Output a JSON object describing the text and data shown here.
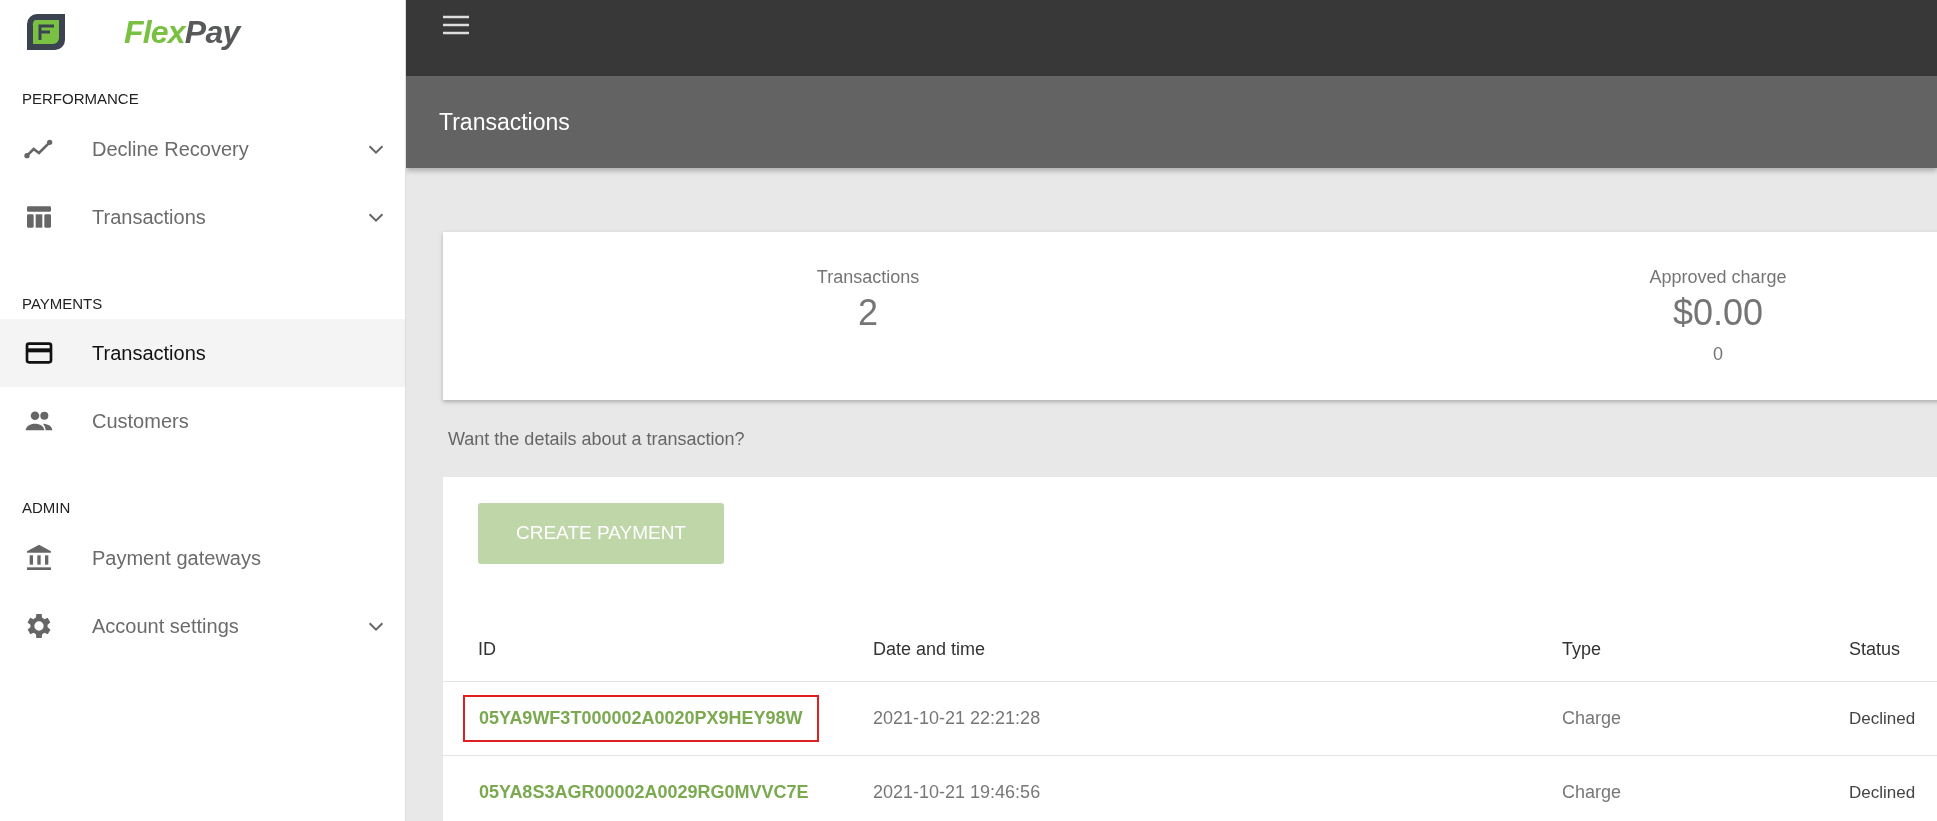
{
  "logo_text": [
    {
      "text": "Flex",
      "color": "#7ac143"
    },
    {
      "text": "Pay",
      "color": "#58595b"
    }
  ],
  "sidebar": {
    "sections": [
      {
        "heading": "PERFORMANCE",
        "items": [
          {
            "kind": "trend",
            "label": "Decline Recovery",
            "expandable": true,
            "selected": false
          },
          {
            "kind": "table",
            "label": "Transactions",
            "expandable": true,
            "selected": false
          }
        ]
      },
      {
        "heading": "PAYMENTS",
        "items": [
          {
            "kind": "card",
            "label": "Transactions",
            "expandable": false,
            "selected": true
          },
          {
            "kind": "people",
            "label": "Customers",
            "expandable": false,
            "selected": false
          }
        ]
      },
      {
        "heading": "ADMIN",
        "items": [
          {
            "kind": "bank",
            "label": "Payment gateways",
            "expandable": false,
            "selected": false
          },
          {
            "kind": "gear",
            "label": "Account settings",
            "expandable": true,
            "selected": false
          }
        ]
      }
    ]
  },
  "page_title": "Transactions",
  "summary": [
    {
      "label": "Transactions",
      "value": "2"
    },
    {
      "label": "Approved charge",
      "value": "$0.00",
      "sub": "0"
    }
  ],
  "hint": "Want the details about a transaction?",
  "create_button": {
    "label": "CREATE PAYMENT",
    "disabled": true
  },
  "table": {
    "columns": [
      "ID",
      "Date and time",
      "Type",
      "Status"
    ],
    "rows": [
      {
        "id": "05YA9WF3T000002A0020PX9HEY98W",
        "datetime": "2021-10-21 22:21:28",
        "type": "Charge",
        "status": "Declined",
        "highlighted": true
      },
      {
        "id": "05YA8S3AGR00002A0029RG0MVVC7E",
        "datetime": "2021-10-21 19:46:56",
        "type": "Charge",
        "status": "Declined",
        "highlighted": false
      }
    ]
  }
}
